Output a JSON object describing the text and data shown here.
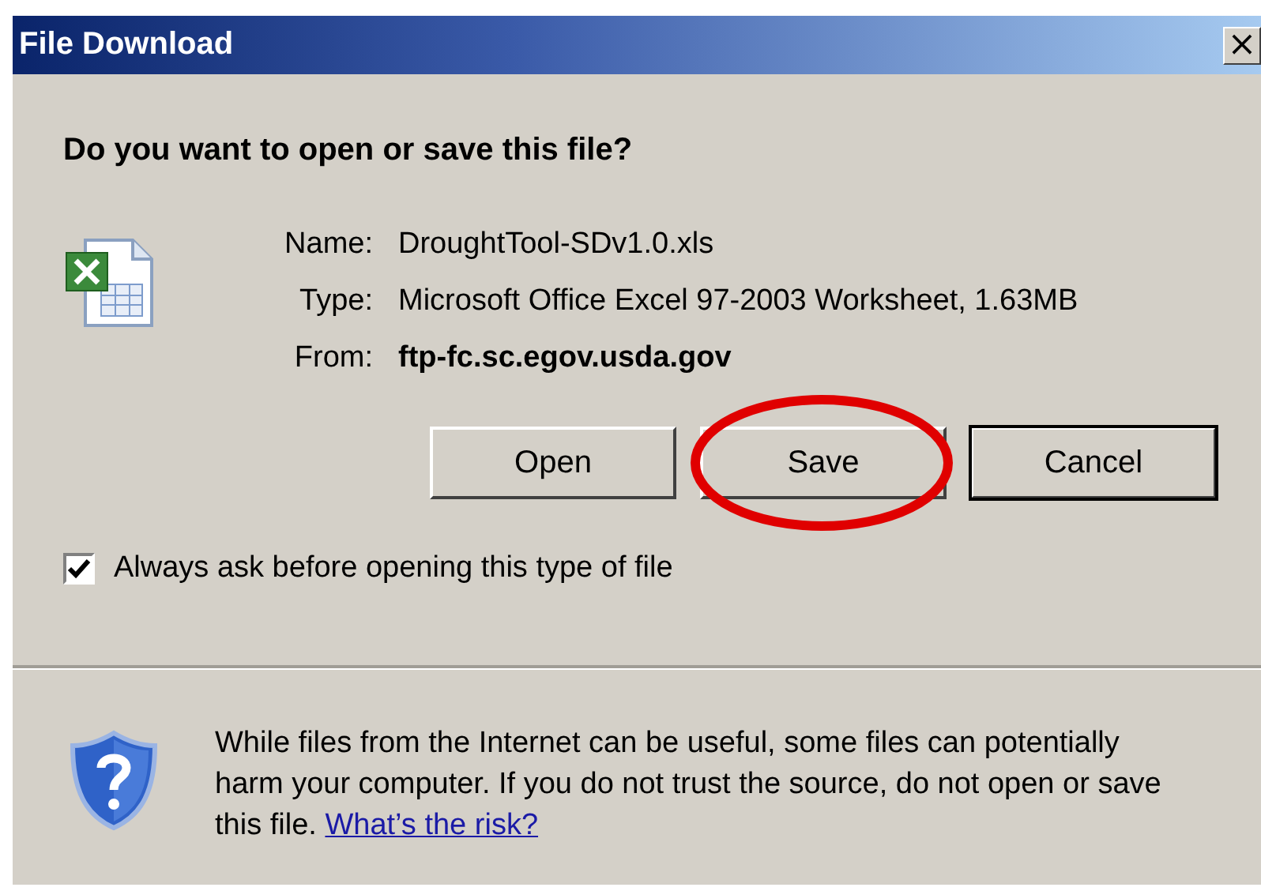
{
  "window": {
    "title": "File Download",
    "close_symbol": "×"
  },
  "question": "Do you want to open or save this file?",
  "file_info": [
    {
      "label": "Name:",
      "value": "DroughtTool-SDv1.0.xls",
      "bold": false
    },
    {
      "label": "Type:",
      "value": "Microsoft Office Excel 97-2003 Worksheet, 1.63MB",
      "bold": false
    },
    {
      "label": "From:",
      "value": "ftp-fc.sc.egov.usda.gov",
      "bold": true
    }
  ],
  "buttons": [
    {
      "label": "Open",
      "default": false,
      "highlighted": false
    },
    {
      "label": "Save",
      "default": false,
      "highlighted": true
    },
    {
      "label": "Cancel",
      "default": true,
      "highlighted": false
    }
  ],
  "always_ask": {
    "label": "Always ask before opening this type of file",
    "checked": true
  },
  "warning": {
    "text": "While files from the Internet can be useful, some files can potentially harm your computer. If you do not trust the source, do not open or save this file.",
    "link": "What’s the risk?"
  }
}
